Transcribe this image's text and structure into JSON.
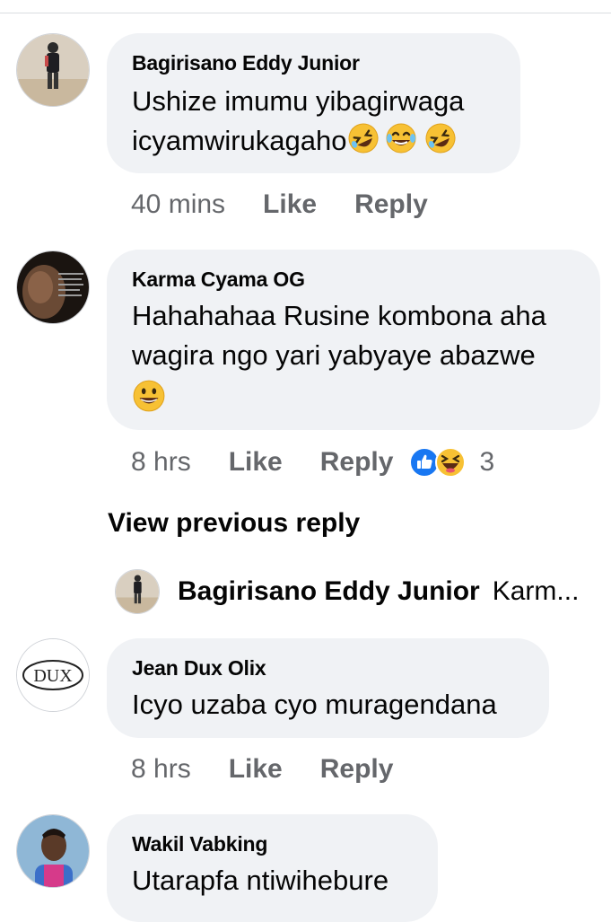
{
  "comments": [
    {
      "author": "Bagirisano Eddy Junior",
      "text_line1": "Ushize imumu yibagirwaga",
      "text_line2": "icyamwirukagaho",
      "time": "40 mins",
      "like_label": "Like",
      "reply_label": "Reply",
      "emojis": [
        "rolling-on-floor-laughing-emoji",
        "tears-of-joy-emoji",
        "rolling-on-floor-laughing-emoji"
      ]
    },
    {
      "author": "Karma Cyama OG",
      "text_line1": "Hahahahaa Rusine kombona aha",
      "text_line2": "wagira ngo yari yabyaye abazwe",
      "time": "8 hrs",
      "like_label": "Like",
      "reply_label": "Reply",
      "reaction_count": "3",
      "emojis": [
        "grinning-face-emoji"
      ],
      "reactions": [
        "like-reaction-icon",
        "haha-reaction-icon"
      ]
    },
    {
      "author": "Jean Dux Olix",
      "avatar_text": "DUX",
      "text_line1": "Icyo uzaba cyo muragendana",
      "time": "8 hrs",
      "like_label": "Like",
      "reply_label": "Reply"
    },
    {
      "author": "Wakil Vabking",
      "text_line1": "Utarapfa ntiwihebure"
    }
  ],
  "view_previous": "View previous reply",
  "nested_reply": {
    "author": "Bagirisano Eddy Junior",
    "preview": "Karm..."
  },
  "colors": {
    "bubble": "#f0f2f5",
    "meta": "#65676b",
    "text": "#050505",
    "like_blue": "#1877f2",
    "emoji_yellow": "#f7c134"
  }
}
